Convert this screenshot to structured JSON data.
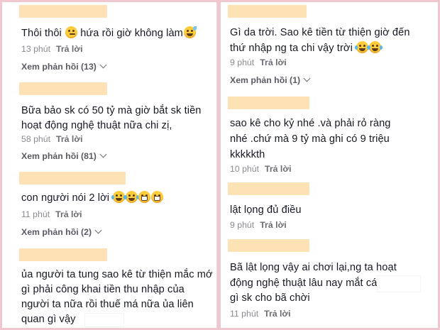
{
  "left": {
    "comments": [
      {
        "lines": [
          "Thôi thôi",
          "hứa rồi giờ không làm"
        ],
        "time": "13 phút",
        "reply": "Trả lời",
        "more": "Xem phản hồi (13)"
      },
      {
        "lines": [
          "Bữa bảo sk có 50 tỷ mà giờ bắt sk tiền",
          "hoạt động nghệ thuật nữa chi zị,"
        ],
        "time": "58 phút",
        "reply": "Trả lời",
        "more": "Xem phản hồi (81)"
      },
      {
        "lines": [
          "con người nói 2 lời"
        ],
        "time": "11 phút",
        "reply": "Trả lời",
        "more": "Xem phản hồi (2)"
      },
      {
        "lines": [
          "ủa người ta tung sao kê từ thiện mắc mớ",
          "gì phải công khai tiền thu nhập của",
          "người ta nữa rồi thuế má nữa ủa liên",
          "quan gì vậy"
        ]
      }
    ]
  },
  "right": {
    "comments": [
      {
        "lines": [
          "Gì da trời. Sao kê tiền từ thiện giờ đến",
          "thứ nhập ng ta chi vậy trời"
        ],
        "time": "9 phút",
        "reply": "Trả lời",
        "more": "Xem phản hồi (1)"
      },
      {
        "lines": [
          "sao kê cho kỷ nhé .và phải rỏ ràng",
          "nhé .chứ mà 9 tỷ mà ghi có 9 triệu",
          "kkkkkth"
        ],
        "time": "10 phút",
        "reply": "Trả lời"
      },
      {
        "lines": [
          "lật lọng đủ điều"
        ],
        "time": "9 phút",
        "reply": "Trả lời"
      },
      {
        "lines": [
          "Bã lật lọng vậy ai chơi lại,ng ta hoạt",
          "động nghệ thuật lâu nay mắt cái",
          "gì sk cho bã chời"
        ],
        "time": "11 phút",
        "reply": "Trả lời"
      }
    ]
  }
}
